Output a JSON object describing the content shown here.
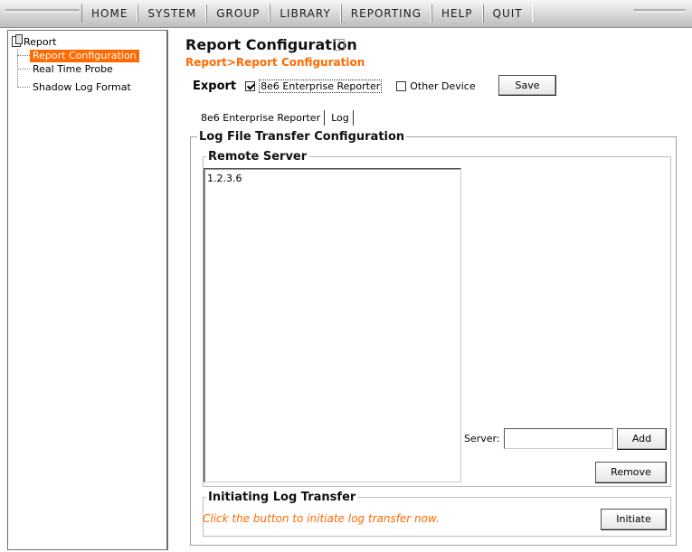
{
  "menu": {
    "items": [
      {
        "label": "HOME"
      },
      {
        "label": "SYSTEM"
      },
      {
        "label": "GROUP"
      },
      {
        "label": "LIBRARY"
      },
      {
        "label": "REPORTING"
      },
      {
        "label": "HELP"
      },
      {
        "label": "QUIT"
      }
    ]
  },
  "tree": {
    "root": "Report",
    "items": [
      {
        "label": "Report Configuration",
        "selected": true
      },
      {
        "label": "Real Time Probe",
        "selected": false
      },
      {
        "label": "Shadow Log Format",
        "selected": false
      }
    ]
  },
  "page": {
    "title": "Report Configuration",
    "help_glyph": "?",
    "breadcrumb": "Report>Report Configuration"
  },
  "export": {
    "label": "Export",
    "option1_label": "8e6 Enterprise Reporter",
    "option1_checked": true,
    "option2_label": "Other Device",
    "option2_checked": false,
    "save_label": "Save"
  },
  "tabs": [
    {
      "label": "8e6 Enterprise Reporter",
      "active": true
    },
    {
      "label": "Log",
      "active": false
    }
  ],
  "log_transfer": {
    "title": "Log File Transfer Configuration",
    "remote_server": {
      "title": "Remote Server",
      "servers": [
        "1.2.3.6"
      ],
      "server_label": "Server:",
      "server_value": "",
      "add_label": "Add",
      "remove_label": "Remove"
    },
    "initiating": {
      "title": "Initiating Log Transfer",
      "hint": "Click the button to initiate log transfer now.",
      "button_label": "Initiate"
    }
  },
  "colors": {
    "accent": "#ff6a00",
    "selection_bg": "#ff6a00"
  }
}
